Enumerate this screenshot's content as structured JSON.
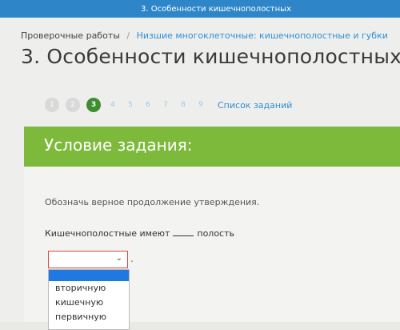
{
  "header": {
    "title": "3. Особенности кишечнополостных"
  },
  "breadcrumb": {
    "home": "Проверочные работы",
    "separator": "/",
    "current": "Низшие многоклеточные: кишечнополостные и губки"
  },
  "page": {
    "title": "3. Особенности кишечнополостных"
  },
  "pager": {
    "items": [
      "1",
      "2",
      "3",
      "4",
      "5",
      "6",
      "7",
      "8",
      "9"
    ],
    "active": "3",
    "task_list_label": "Список заданий"
  },
  "task": {
    "banner_title": "Условие задания:",
    "instruction": "Обозначь верное продолжение утверждения.",
    "statement_before": "Кишечнополостные имеют",
    "statement_after": "полость",
    "select": {
      "value": "",
      "options": [
        "вторичную",
        "кишечную",
        "первичную"
      ]
    },
    "trailing_dot": "."
  },
  "colors": {
    "topbar": "#2e86c9",
    "banner": "#7dba3c",
    "active_page": "#3d8e2f",
    "link": "#2f8fd6",
    "select_border": "#e24444",
    "highlight": "#1e7ae0"
  }
}
